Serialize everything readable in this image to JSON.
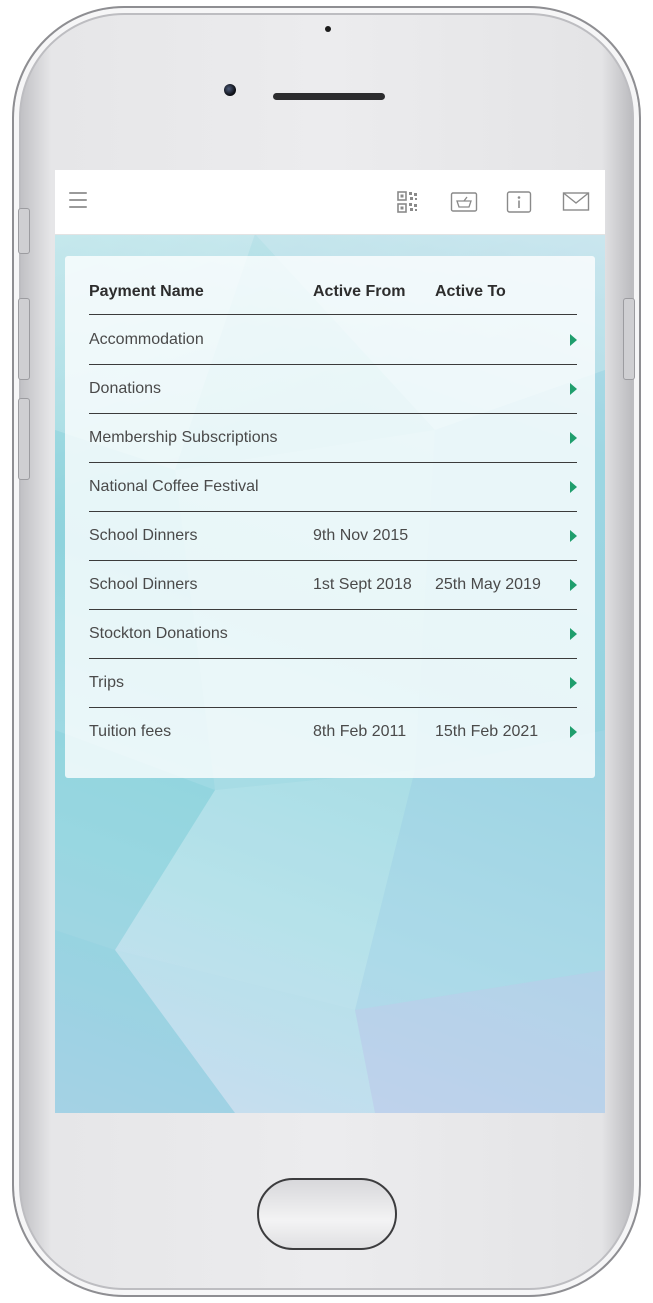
{
  "icons": {
    "menu": "hamburger-menu-icon",
    "qr": "qr-code-icon",
    "basket": "basket-icon",
    "info": "info-icon",
    "mail": "mail-icon"
  },
  "colors": {
    "accent_arrow": "#1f9e6d",
    "appbar_bg": "#ffffff",
    "screen_bg": "#9ad7df"
  },
  "table": {
    "headers": {
      "payment_name": "Payment Name",
      "active_from": "Active From",
      "active_to": "Active To"
    },
    "rows": [
      {
        "name": "Accommodation",
        "active_from": "",
        "active_to": ""
      },
      {
        "name": "Donations",
        "active_from": "",
        "active_to": ""
      },
      {
        "name": "Membership Subscriptions",
        "active_from": "",
        "active_to": ""
      },
      {
        "name": "National Coffee Festival",
        "active_from": "",
        "active_to": ""
      },
      {
        "name": "School Dinners",
        "active_from": "9th Nov 2015",
        "active_to": ""
      },
      {
        "name": "School Dinners",
        "active_from": "1st Sept 2018",
        "active_to": "25th May 2019"
      },
      {
        "name": "Stockton Donations",
        "active_from": "",
        "active_to": ""
      },
      {
        "name": "Trips",
        "active_from": "",
        "active_to": ""
      },
      {
        "name": "Tuition fees",
        "active_from": "8th Feb 2011",
        "active_to": "15th Feb 2021"
      }
    ]
  }
}
